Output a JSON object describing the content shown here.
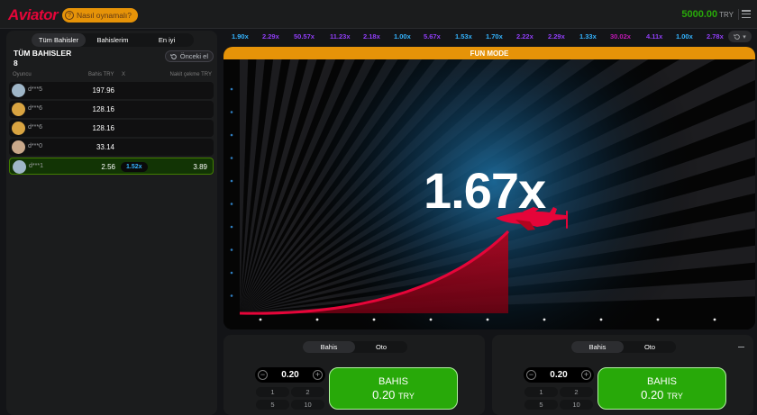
{
  "header": {
    "logo": "Aviator",
    "how_to": "Nasıl oynamalı?",
    "balance": "5000.00",
    "currency": "TRY"
  },
  "bets_panel": {
    "tabs": [
      "Tüm Bahisler",
      "Bahislerim",
      "En iyi"
    ],
    "title": "TÜM BAHISLER",
    "count": "8",
    "prev_button": "Önceki el",
    "columns": {
      "player": "Oyuncu",
      "bet": "Bahis TRY",
      "x": "X",
      "cashout": "Nakit çekme TRY"
    },
    "rows": [
      {
        "player": "d***5",
        "bet": "197.96",
        "mult": "",
        "cashout": "",
        "avatar_color": "#9fb6c8"
      },
      {
        "player": "d***6",
        "bet": "128.16",
        "mult": "",
        "cashout": "",
        "avatar_color": "#d9a441"
      },
      {
        "player": "d***6",
        "bet": "128.16",
        "mult": "",
        "cashout": "",
        "avatar_color": "#d9a441"
      },
      {
        "player": "d***0",
        "bet": "33.14",
        "mult": "",
        "cashout": "",
        "avatar_color": "#c9a88a"
      },
      {
        "player": "d***1",
        "bet": "2.56",
        "mult": "1.52x",
        "cashout": "3.89",
        "avatar_color": "#9fb6c8"
      }
    ]
  },
  "history": [
    {
      "v": "1.90x",
      "c": "#34b4ff"
    },
    {
      "v": "2.29x",
      "c": "#913ef8"
    },
    {
      "v": "50.57x",
      "c": "#913ef8"
    },
    {
      "v": "11.23x",
      "c": "#913ef8"
    },
    {
      "v": "2.18x",
      "c": "#913ef8"
    },
    {
      "v": "1.00x",
      "c": "#34b4ff"
    },
    {
      "v": "5.67x",
      "c": "#913ef8"
    },
    {
      "v": "1.53x",
      "c": "#34b4ff"
    },
    {
      "v": "1.70x",
      "c": "#34b4ff"
    },
    {
      "v": "2.22x",
      "c": "#913ef8"
    },
    {
      "v": "2.29x",
      "c": "#913ef8"
    },
    {
      "v": "1.33x",
      "c": "#34b4ff"
    },
    {
      "v": "30.02x",
      "c": "#c017b4"
    },
    {
      "v": "4.11x",
      "c": "#913ef8"
    },
    {
      "v": "1.00x",
      "c": "#34b4ff"
    },
    {
      "v": "2.78x",
      "c": "#913ef8"
    }
  ],
  "game": {
    "mode_label": "FUN MODE",
    "multiplier": "1.67x"
  },
  "bet_panels": [
    {
      "tabs": [
        "Bahis",
        "Oto"
      ],
      "amount": "0.20",
      "quick": [
        "1",
        "2",
        "5",
        "10"
      ],
      "button_label": "BAHIS",
      "button_amount": "0.20",
      "button_currency": "TRY"
    },
    {
      "tabs": [
        "Bahis",
        "Oto"
      ],
      "amount": "0.20",
      "quick": [
        "1",
        "2",
        "5",
        "10"
      ],
      "button_label": "BAHIS",
      "button_amount": "0.20",
      "button_currency": "TRY"
    }
  ],
  "colors": {
    "accent_red": "#e50539",
    "accent_green": "#28a909",
    "accent_orange": "#e69308"
  }
}
